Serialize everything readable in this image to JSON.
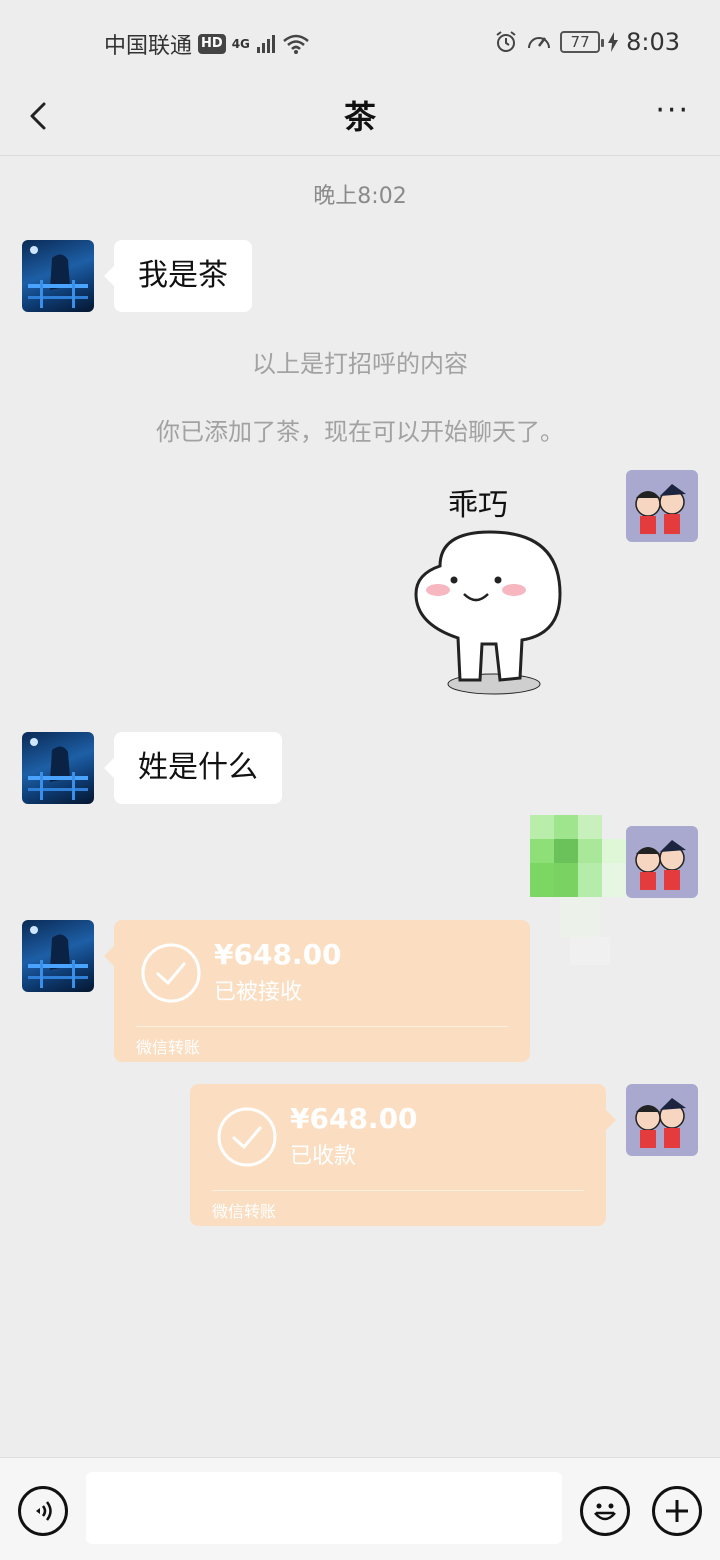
{
  "status_bar": {
    "carrier": "中国联通",
    "hd": "HD",
    "network": "4G",
    "battery": "77",
    "time": "8:03"
  },
  "title_bar": {
    "title": "茶",
    "back_icon": "chevron-left-icon",
    "more_label": "···"
  },
  "chat": {
    "timestamp": "晚上8:02",
    "messages": [
      {
        "side": "left",
        "type": "text",
        "text": "我是茶"
      },
      {
        "side": "system",
        "type": "system",
        "text": "以上是打招呼的内容"
      },
      {
        "side": "system",
        "type": "system",
        "text": "你已添加了茶，现在可以开始聊天了。"
      },
      {
        "side": "right",
        "type": "sticker",
        "caption": "乖巧"
      },
      {
        "side": "left",
        "type": "text",
        "text": "姓是什么"
      },
      {
        "side": "right",
        "type": "image",
        "text": ""
      },
      {
        "side": "left",
        "type": "transfer",
        "amount": "¥648.00",
        "status": "已被接收",
        "label": "微信转账"
      },
      {
        "side": "right",
        "type": "transfer",
        "amount": "¥648.00",
        "status": "已收款",
        "label": "微信转账"
      }
    ]
  },
  "input_bar": {
    "voice_icon": "voice-icon",
    "emoji_icon": "emoji-icon",
    "plus_icon": "plus-icon",
    "input_value": ""
  },
  "colors": {
    "background": "#ededed",
    "transfer_bg": "#fbdec1",
    "bubble_bg": "#ffffff"
  }
}
